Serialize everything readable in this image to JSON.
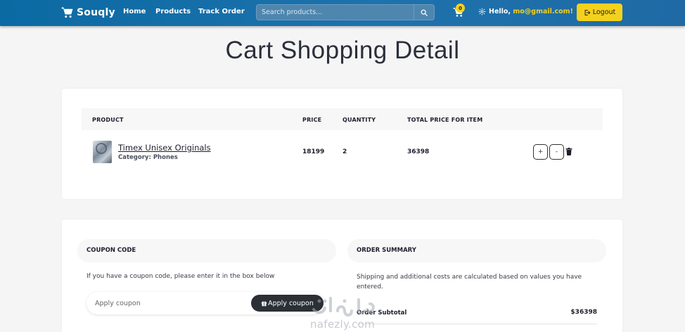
{
  "navbar": {
    "brand": "Souqly",
    "links": [
      "Home",
      "Products",
      "Track Order"
    ],
    "search_placeholder": "Search products...",
    "cart_count": "0",
    "greeting": "Hello,",
    "user_email": "mo@gmail.com!",
    "logout_label": "Logout"
  },
  "page_title": "Cart Shopping Detail",
  "cart_table": {
    "headers": [
      "PRODUCT",
      "PRICE",
      "QUANTITY",
      "TOTAL PRICE FOR ITEM"
    ],
    "rows": [
      {
        "name": "Timex Unisex Originals",
        "category": "Category: Phones",
        "price": "18199",
        "quantity": "2",
        "total": "36398",
        "increment_label": "+",
        "decrement_label": "-"
      }
    ]
  },
  "coupon": {
    "title": "COUPON CODE",
    "description": "If you have a coupon code, please enter it in the box below",
    "placeholder": "Apply coupon",
    "button_label": "Apply coupon"
  },
  "order_summary": {
    "title": "ORDER SUMMARY",
    "description": "Shipping and additional costs are calculated based on values you have entered.",
    "subtotal_label": "Order Subtotal",
    "subtotal_value": "$36398"
  },
  "watermark": {
    "text": "nafezly.com"
  },
  "colors": {
    "navbar": "#1e72ad",
    "accent_yellow": "#f4d11d",
    "dark_button": "#2b2f36"
  },
  "icons": [
    "cart-icon",
    "search-icon",
    "gear-icon",
    "logout-icon",
    "trash-icon",
    "gift-icon"
  ]
}
